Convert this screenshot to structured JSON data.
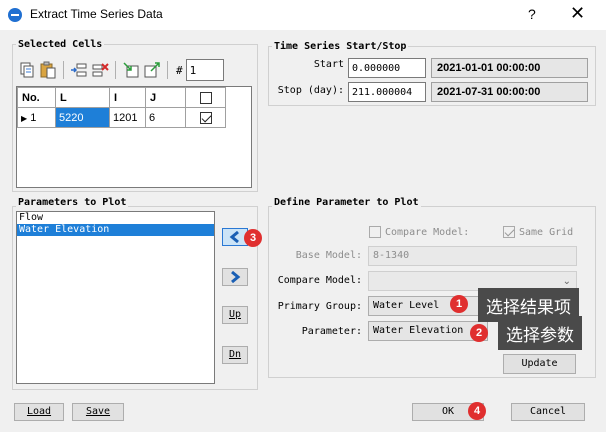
{
  "window": {
    "title": "Extract Time Series Data",
    "help": "?",
    "close": "✕"
  },
  "selected_cells": {
    "label": "Selected Cells",
    "hash_label": "#",
    "count_value": "1",
    "columns": [
      "No.",
      "L",
      "I",
      "J"
    ],
    "rows": [
      {
        "no": "1",
        "L": "5220",
        "I": "1201",
        "J": "6",
        "checked": true
      }
    ]
  },
  "time_series": {
    "label": "Time Series Start/Stop",
    "start_label": "Start",
    "start_value": "0.000000",
    "start_datetime": "2021-01-01 00:00:00",
    "stop_label": "Stop (day):",
    "stop_value": "211.000004",
    "stop_datetime": "2021-07-31 00:00:00"
  },
  "parameters": {
    "label": "Parameters to Plot",
    "items": [
      "Flow",
      "Water Elevation"
    ],
    "selected_index": 1,
    "up_label": "Up",
    "dn_label": "Dn"
  },
  "define": {
    "label": "Define Parameter to Plot",
    "compare_model_check": "Compare Model:",
    "same_grid_check": "Same Grid",
    "base_model_label": "Base Model:",
    "base_model_value": "8-1340",
    "compare_model_label": "Compare Model:",
    "compare_model_value": "",
    "primary_group_label": "Primary Group:",
    "primary_group_value": "Water Level",
    "parameter_label": "Parameter:",
    "parameter_value": "Water Elevation",
    "update_label": "Update"
  },
  "footer": {
    "load_label": "Load",
    "save_label": "Save",
    "ok_label": "OK",
    "cancel_label": "Cancel"
  },
  "annotations": {
    "badge1": "1",
    "badge2": "2",
    "badge3": "3",
    "badge4": "4",
    "tip1": "选择结果项",
    "tip2": "选择参数"
  },
  "colors": {
    "selection": "#1e7fd8",
    "badge": "#e02f2f",
    "tooltip": "#4a4a4a"
  }
}
